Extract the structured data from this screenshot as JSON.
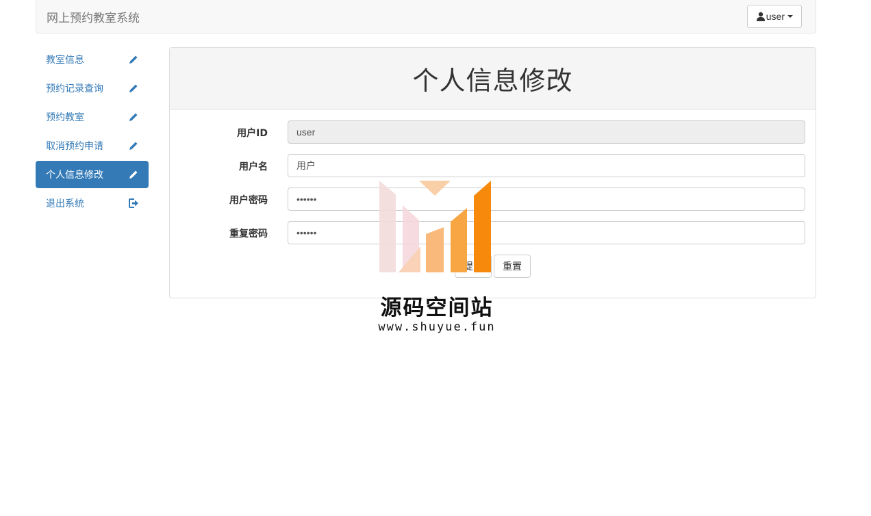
{
  "navbar": {
    "brand": "网上预约教室系统",
    "user_label": "user"
  },
  "sidebar": {
    "items": [
      {
        "label": "教室信息",
        "icon": "pencil-icon"
      },
      {
        "label": "预约记录查询",
        "icon": "pencil-icon"
      },
      {
        "label": "预约教室",
        "icon": "pencil-icon"
      },
      {
        "label": "取消预约申请",
        "icon": "pencil-icon"
      },
      {
        "label": "个人信息修改",
        "icon": "pencil-icon",
        "active": true
      },
      {
        "label": "退出系统",
        "icon": "logout-icon"
      }
    ]
  },
  "panel": {
    "title": "个人信息修改",
    "fields": {
      "user_id": {
        "label": "用户ID",
        "value": "user",
        "disabled": true
      },
      "username": {
        "label": "用户名",
        "value": "用户"
      },
      "password": {
        "label": "用户密码",
        "value": "123456"
      },
      "password_repeat": {
        "label": "重复密码",
        "value": "123456"
      }
    },
    "submit_label": "提交",
    "reset_label": "重置"
  },
  "watermark": {
    "title": "源码空间站",
    "url": "www.shuyue.fun"
  },
  "colors": {
    "primary": "#337ab7",
    "navbar_bg": "#f8f8f8",
    "watermark_orange": "#f7890c"
  }
}
